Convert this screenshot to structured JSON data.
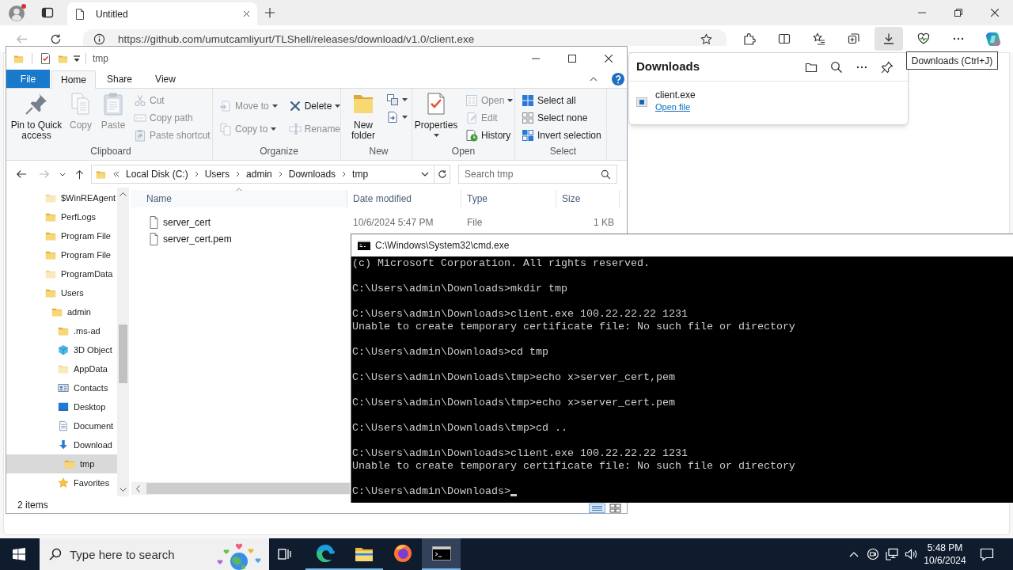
{
  "browser": {
    "tabs": [
      {
        "title": "Untitled",
        "selected": true
      }
    ],
    "address_bar": {
      "url": "https://github.com/umutcamliyurt/TLShell/releases/download/v1.0/client.exe"
    },
    "downloads_button": {
      "pressed": true
    },
    "tooltip": "Downloads (Ctrl+J)",
    "downloads_panel": {
      "title": "Downloads",
      "items": [
        {
          "file_name": "client.exe",
          "action": "Open file"
        }
      ]
    }
  },
  "explorer": {
    "title": "tmp",
    "ribbon_tabs": [
      {
        "label": "File",
        "kind": "menu",
        "selected": false
      },
      {
        "label": "Home",
        "kind": "tab",
        "selected": true
      },
      {
        "label": "Share",
        "kind": "tab",
        "selected": false
      },
      {
        "label": "View",
        "kind": "tab",
        "selected": false
      }
    ],
    "ribbon_groups": [
      {
        "label": "Clipboard",
        "buttons": [
          {
            "kind": "large",
            "label": "Pin to Quick access",
            "disabled": false,
            "dropdown": false
          },
          {
            "kind": "large",
            "label": "Copy",
            "disabled": true,
            "dropdown": false
          },
          {
            "kind": "large",
            "label": "Paste",
            "disabled": true,
            "dropdown": false
          },
          {
            "kind": "small",
            "label": "Cut",
            "disabled": true,
            "dropdown": false
          },
          {
            "kind": "small",
            "label": "Copy path",
            "disabled": true,
            "dropdown": false
          },
          {
            "kind": "small",
            "label": "Paste shortcut",
            "disabled": true,
            "dropdown": false
          }
        ]
      },
      {
        "label": "Organize",
        "buttons": [
          {
            "kind": "small",
            "label": "Move to",
            "disabled": true,
            "dropdown": true
          },
          {
            "kind": "small",
            "label": "Copy to",
            "disabled": true,
            "dropdown": true
          },
          {
            "kind": "small",
            "label": "Delete",
            "disabled": false,
            "dropdown": true
          },
          {
            "kind": "small",
            "label": "Rename",
            "disabled": true,
            "dropdown": false
          }
        ]
      },
      {
        "label": "New",
        "buttons": [
          {
            "kind": "large",
            "label": "New folder",
            "disabled": false,
            "dropdown": false
          },
          {
            "kind": "small",
            "disabled": false,
            "dropdown": true
          },
          {
            "kind": "small",
            "disabled": false,
            "dropdown": true
          }
        ]
      },
      {
        "label": "Open",
        "buttons": [
          {
            "kind": "large",
            "label": "Properties",
            "disabled": false,
            "dropdown": true
          },
          {
            "kind": "small",
            "label": "Open",
            "disabled": true,
            "dropdown": true
          },
          {
            "kind": "small",
            "label": "Edit",
            "disabled": true,
            "dropdown": false
          },
          {
            "kind": "small",
            "label": "History",
            "disabled": false,
            "dropdown": false
          }
        ]
      },
      {
        "label": "Select",
        "buttons": [
          {
            "kind": "small",
            "label": "Select all",
            "disabled": false,
            "dropdown": false
          },
          {
            "kind": "small",
            "label": "Select none",
            "disabled": false,
            "dropdown": false
          },
          {
            "kind": "small",
            "label": "Invert selection",
            "disabled": false,
            "dropdown": false
          }
        ]
      }
    ],
    "address": {
      "segments": [
        "Local Disk (C:)",
        "Users",
        "admin",
        "Downloads",
        "tmp"
      ]
    },
    "search": {
      "placeholder": "Search tmp"
    },
    "nav_tree": [
      {
        "label": "$WinREAgent",
        "kind": "folder",
        "hidden": true,
        "selected": false
      },
      {
        "label": "PerfLogs",
        "kind": "folder",
        "hidden": false,
        "selected": false
      },
      {
        "label": "Program File",
        "kind": "folder",
        "hidden": false,
        "selected": false
      },
      {
        "label": "Program File",
        "kind": "folder",
        "hidden": false,
        "selected": false
      },
      {
        "label": "ProgramData",
        "kind": "folder",
        "hidden": true,
        "selected": false
      },
      {
        "label": "Users",
        "kind": "folder",
        "hidden": false,
        "selected": false,
        "children": [
          {
            "label": "admin",
            "kind": "folder",
            "hidden": false,
            "selected": false,
            "children": [
              {
                "label": ".ms-ad",
                "kind": "folder",
                "hidden": false,
                "selected": false
              },
              {
                "label": "3D Object",
                "kind": "cube",
                "hidden": false,
                "selected": false
              },
              {
                "label": "AppData",
                "kind": "folder",
                "hidden": true,
                "selected": false
              },
              {
                "label": "Contacts",
                "kind": "contacts",
                "hidden": false,
                "selected": false
              },
              {
                "label": "Desktop",
                "kind": "desktop",
                "hidden": false,
                "selected": false
              },
              {
                "label": "Document",
                "kind": "documents",
                "hidden": false,
                "selected": false
              },
              {
                "label": "Download",
                "kind": "downloads",
                "hidden": false,
                "selected": false,
                "children": [
                  {
                    "label": "tmp",
                    "kind": "folder",
                    "hidden": false,
                    "selected": true
                  }
                ]
              },
              {
                "label": "Favorites",
                "kind": "favorites",
                "hidden": false,
                "selected": false
              }
            ]
          }
        ]
      }
    ],
    "file_list": {
      "columns": [
        {
          "label": "Name",
          "sorted": true
        },
        {
          "label": "Date modified",
          "sorted": false
        },
        {
          "label": "Type",
          "sorted": false
        },
        {
          "label": "Size",
          "sorted": false
        }
      ],
      "rows": [
        {
          "cells": [
            "server_cert",
            "10/6/2024 5:47 PM",
            "File",
            "1 KB"
          ]
        },
        {
          "cells": [
            "server_cert.pem"
          ]
        }
      ]
    },
    "status_bar": "2 items"
  },
  "cmd": {
    "title": "C:\\Windows\\System32\\cmd.exe",
    "blocks": [
      [
        "(c) Microsoft Corporation. All rights reserved."
      ],
      [
        "C:\\Users\\admin\\Downloads>mkdir tmp"
      ],
      [
        "C:\\Users\\admin\\Downloads>client.exe 100.22.22.22 1231",
        "Unable to create temporary certificate file: No such file or directory"
      ],
      [
        "C:\\Users\\admin\\Downloads>cd tmp"
      ],
      [
        "C:\\Users\\admin\\Downloads\\tmp>echo x>server_cert,pem"
      ],
      [
        "C:\\Users\\admin\\Downloads\\tmp>echo x>server_cert.pem"
      ],
      [
        "C:\\Users\\admin\\Downloads\\tmp>cd .."
      ],
      [
        "C:\\Users\\admin\\Downloads>client.exe 100.22.22.22 1231",
        "Unable to create temporary certificate file: No such file or directory"
      ],
      [
        "C:\\Users\\admin\\Downloads>"
      ]
    ]
  },
  "taskbar": {
    "search": {
      "placeholder": "Type here to search"
    },
    "apps": [
      {
        "running": true,
        "selected": false
      },
      {
        "running": true,
        "selected": false
      },
      {
        "running": false,
        "selected": false
      },
      {
        "running": true,
        "selected": true
      }
    ],
    "clock": {
      "time": "5:48 PM",
      "date": "10/6/2024"
    }
  }
}
